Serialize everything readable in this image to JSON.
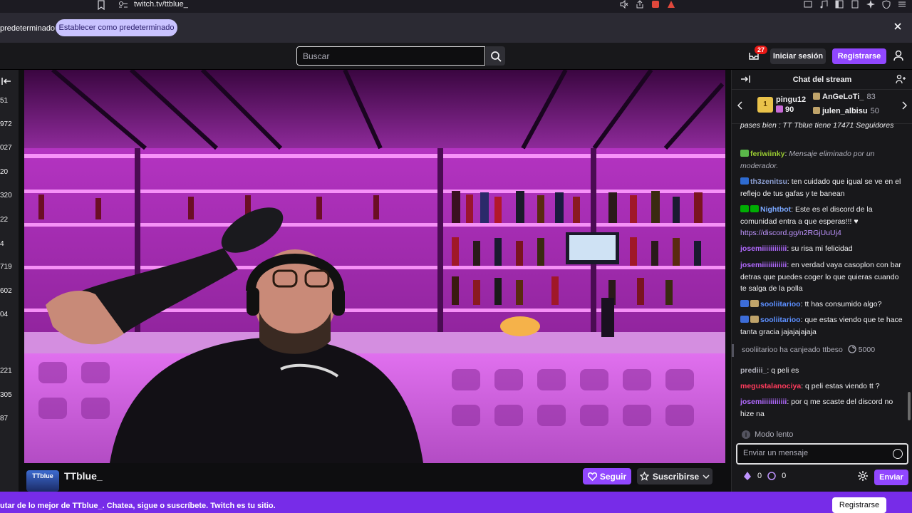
{
  "browser": {
    "url": "twitch.tv/ttblue_"
  },
  "notice": {
    "left_text": "predeterminado",
    "button": "Establecer como predeterminado"
  },
  "nav": {
    "search_placeholder": "Buscar",
    "inbox_count": "27",
    "login": "Iniciar sesión",
    "signup": "Registrarse"
  },
  "sidebar": {
    "counts": [
      "51",
      "972",
      "027",
      "20",
      "320",
      "22",
      "4",
      "719",
      "602",
      "04",
      "221",
      "305",
      "87"
    ]
  },
  "channel": {
    "avatar_text": "TTblue",
    "name": "TTblue_",
    "follow": "Seguir",
    "subscribe": "Suscribirse"
  },
  "chat": {
    "title": "Chat del stream",
    "leaderboard": [
      {
        "user": "pingu12",
        "count": "90"
      },
      {
        "user": "AnGeLoTi_",
        "count": "83"
      },
      {
        "user": "julen_albisu",
        "count": "50"
      }
    ],
    "messages": [
      {
        "user": "",
        "text": "pases bien : TT Tblue tiene 17471 Seguidores",
        "color": "#efeff1"
      },
      {
        "user": "feriwiinky",
        "text": "Mensaje eliminado por un moderador.",
        "color": "#9acd32",
        "deleted": true
      },
      {
        "user": "th3zenitsu",
        "text": "ten cuidado que igual se ve en el reflejo de tus gafas y te banean",
        "color": "#8a9ccf"
      },
      {
        "user": "Nightbot",
        "text": "Este es el discord de la comunidad entra a que esperas!!! ♥",
        "link": "https://discord.gg/n2RGjUuUj4",
        "color": "#7aa7ff"
      },
      {
        "user": "josemiiiiiiiiiiii",
        "text": "su risa mi felicidad",
        "color": "#b169ff"
      },
      {
        "user": "josemiiiiiiiiiiii",
        "text": "en verdad vaya casoplon con bar detras que puedes coger lo que quieras cuando te salga de la polla",
        "color": "#b169ff"
      },
      {
        "user": "sooliitarioo",
        "text": "tt has consumido algo?",
        "color": "#5c8fff"
      },
      {
        "user": "sooliitarioo",
        "text": "que estas viendo que te hace tanta gracia jajajajajaja",
        "color": "#5c8fff"
      },
      {
        "user": "prediii_",
        "text": "q peli es",
        "color": "#adadb8"
      },
      {
        "user": "megustalanociya",
        "text": "q peli estas viendo tt ?",
        "color": "#ff3b5c"
      },
      {
        "user": "josemiiiiiiiiiiii",
        "text": "por q me scaste del discord no hize na",
        "color": "#b169ff"
      }
    ],
    "redeem": {
      "text": "sooliitarioo ha canjeado ttbeso",
      "points": "5000"
    },
    "slow_mode": "Modo lento",
    "input_placeholder": "Enviar un mensaje",
    "bits": "0",
    "channel_points": "0",
    "send": "Enviar"
  },
  "banner": {
    "text": "utar de lo mejor de TTblue_. Chatea, sigue o suscríbete. Twitch es tu sitio.",
    "button": "Registrarse"
  }
}
